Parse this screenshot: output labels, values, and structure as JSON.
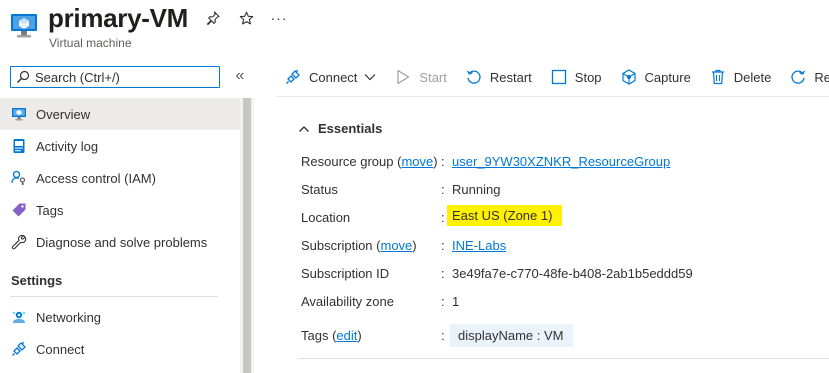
{
  "header": {
    "title": "primary-VM",
    "subtitle": "Virtual machine",
    "more_label": "···",
    "icons": [
      "virtual-machine-icon",
      "pin-icon",
      "star-icon",
      "more-icon"
    ]
  },
  "search": {
    "placeholder": "Search (Ctrl+/)",
    "collapse_label": "«"
  },
  "sidebar": {
    "items": [
      {
        "label": "Overview",
        "icon": "overview-icon",
        "active": true
      },
      {
        "label": "Activity log",
        "icon": "activity-log-icon"
      },
      {
        "label": "Access control (IAM)",
        "icon": "iam-icon"
      },
      {
        "label": "Tags",
        "icon": "tag-icon"
      },
      {
        "label": "Diagnose and solve problems",
        "icon": "wrench-icon"
      }
    ],
    "settings_header": "Settings",
    "settings_items": [
      {
        "label": "Networking",
        "icon": "networking-icon"
      },
      {
        "label": "Connect",
        "icon": "connect-icon"
      }
    ]
  },
  "toolbar": {
    "connect": "Connect",
    "start": "Start",
    "restart": "Restart",
    "stop": "Stop",
    "capture": "Capture",
    "delete": "Delete",
    "refresh": "Refresh"
  },
  "essentials": {
    "header": "Essentials",
    "resource_group_label": "Resource group",
    "resource_group_move": "move",
    "resource_group_value": "user_9YW30XZNKR_ResourceGroup",
    "status_label": "Status",
    "status_value": "Running",
    "location_label": "Location",
    "location_value": "East US (Zone 1)",
    "subscription_label": "Subscription",
    "subscription_move": "move",
    "subscription_value": "INE-Labs",
    "subscription_id_label": "Subscription ID",
    "subscription_id_value": "3e49fa7e-c770-48fe-b408-2ab1b5eddd59",
    "availability_zone_label": "Availability zone",
    "availability_zone_value": "1",
    "tags_label": "Tags",
    "tags_edit": "edit",
    "tag_value": "displayName : VM",
    "colon": ":"
  },
  "colors": {
    "accent": "#0078d4",
    "highlight": "#fff100",
    "active_nav_bg": "#edebe9"
  }
}
